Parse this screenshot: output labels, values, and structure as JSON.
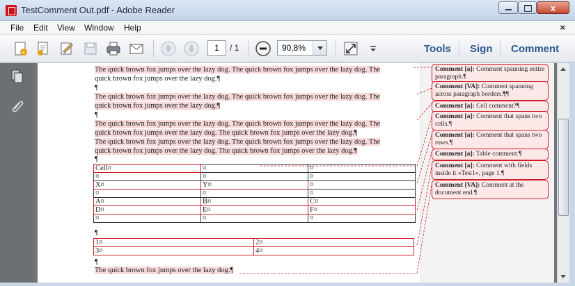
{
  "window": {
    "title": "TestComment Out.pdf - Adobe Reader",
    "close_glyph": "x"
  },
  "menu": {
    "items": [
      "File",
      "Edit",
      "View",
      "Window",
      "Help"
    ],
    "close_glyph": "×"
  },
  "toolbar": {
    "page_current": "1",
    "page_total": "/ 1",
    "zoom": "90,8%",
    "tools_label": "Tools",
    "sign_label": "Sign",
    "comment_label": "Comment"
  },
  "document": {
    "lines": [
      "The quick brown fox jumps over the lazy dog. The quick brown fox jumps over the lazy dog. The",
      "quick brown fox jumps over the lazy dog.¶",
      "¶",
      "The quick brown fox jumps over the lazy dog. The quick brown fox jumps over the lazy dog. The",
      "quick brown fox jumps over the lazy dog.¶",
      "¶",
      "The quick brown fox jumps over the lazy dog. The quick brown fox jumps over the lazy dog. The",
      "quick brown fox jumps over the lazy dog. The quick brown fox jumps over the lazy dog.¶",
      "The quick brown fox jumps over the lazy dog. The quick brown fox jumps over the lazy dog. The",
      "quick brown fox jumps over the lazy dog. The quick brown fox jumps over the lazy dog.¶",
      "¶"
    ],
    "table1": [
      [
        "Cell¤",
        "¤",
        "¤"
      ],
      [
        "¤",
        "¤",
        "¤"
      ],
      [
        "X¤",
        "Y¤",
        "¤"
      ],
      [
        "¤",
        "¤",
        "¤"
      ],
      [
        "A¤",
        "B¤",
        "C¤"
      ],
      [
        "D¤",
        "E¤",
        "F¤"
      ],
      [
        "¤",
        "¤",
        "¤"
      ]
    ],
    "after_table1": "¶",
    "table2": [
      [
        "1¤",
        "2¤"
      ],
      [
        "3¤",
        "4¤"
      ]
    ],
    "after_table2": "¶",
    "last_line": "The quick brown fox jumps over the lazy dog.¶"
  },
  "comments": [
    {
      "author": "Comment [a]:",
      "text": " Comment spanning entire paragraph.¶"
    },
    {
      "author": "Comment [VA]:",
      "text": " Comment spanning across paragraph borders.¶¶"
    },
    {
      "author": "Comment [a]:",
      "text": " Cell comment?¶"
    },
    {
      "author": "Comment [a]:",
      "text": " Comment that spans two cells.¶"
    },
    {
      "author": "Comment [a]:",
      "text": " Comment that spans two rows.¶"
    },
    {
      "author": "Comment [a]:",
      "text": " Table comment.¶"
    },
    {
      "author": "Comment [a]:",
      "text": " Comment with fields inside it «Test1», page 1.¶"
    },
    {
      "author": "Comment [VA]:",
      "text": " Comment at the document end.¶"
    }
  ],
  "colors": {
    "comment_border": "#d21c24",
    "comment_fill": "#fde8e8",
    "highlight": "#f7d9d9",
    "link_blue": "#2b5a8e"
  },
  "icons": [
    "create-pdf-icon",
    "edit-pdf-icon",
    "sign-icon",
    "save-icon",
    "print-icon",
    "email-icon",
    "prev-page-icon",
    "next-page-icon",
    "zoom-out-icon",
    "fit-page-icon",
    "pages-icon",
    "attachment-icon"
  ]
}
